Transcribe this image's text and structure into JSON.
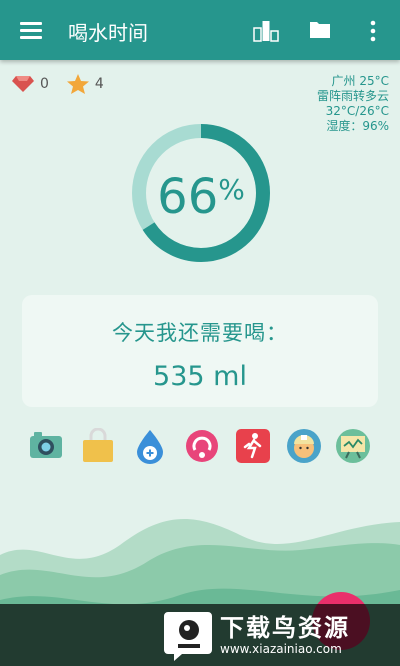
{
  "toolbar": {
    "title": "喝水时间"
  },
  "stats": {
    "gems": "0",
    "stars": "4"
  },
  "weather": {
    "city": "广州 25°C",
    "condition": "雷阵雨转多云",
    "range": "32°C/26°C",
    "humidity": "湿度：96%"
  },
  "progress": {
    "percent_value": 66,
    "number": "66",
    "unit": "%"
  },
  "card": {
    "question": "今天我还需要喝：",
    "amount": "535 ml"
  },
  "features": [
    "camera-icon",
    "shopping-bag-icon",
    "water-drop-add-icon",
    "refresh-icon",
    "exercise-icon",
    "nurse-avatar-icon",
    "presentation-chart-icon"
  ],
  "watermark": {
    "text": "下载鸟资源",
    "url": "www.xiazainiao.com"
  },
  "colors": {
    "primary": "#26968d",
    "accent": "#ea2f6b",
    "background": "#e3f2ec"
  }
}
